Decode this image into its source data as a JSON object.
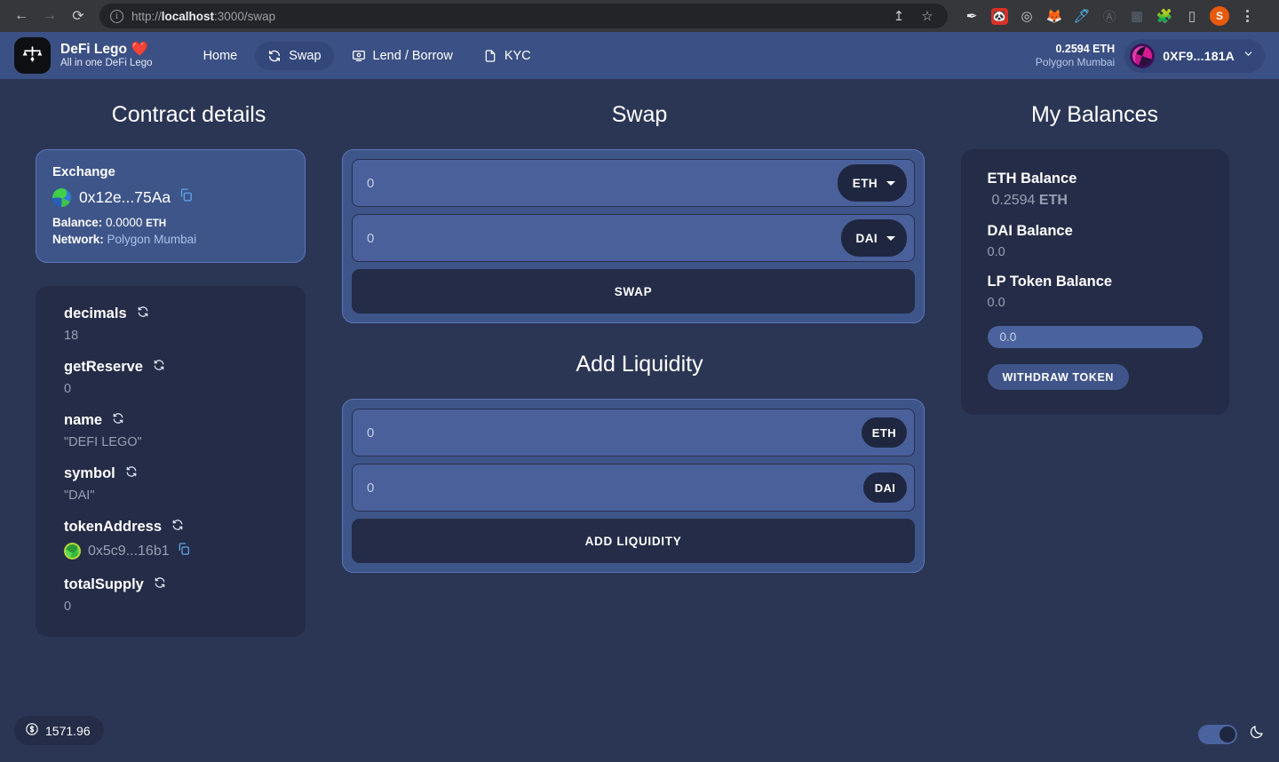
{
  "browser": {
    "back_label": "←",
    "forward_label": "→",
    "reload_label": "⟳",
    "url_prefix": "http://",
    "url_host": "localhost",
    "url_rest": ":3000/swap",
    "share_label": "↥",
    "bookmark_label": "☆",
    "extensions": [
      {
        "name": "pen-extension-icon",
        "glyph": "✒",
        "bg": "transparent",
        "color": "#e8eaed"
      },
      {
        "name": "red-panda-extension-icon",
        "glyph": "🐼",
        "bg": "#d93025",
        "color": "#ffffff"
      },
      {
        "name": "target-extension-icon",
        "glyph": "◎",
        "bg": "transparent",
        "color": "#e8eaed"
      },
      {
        "name": "metamask-extension-icon",
        "glyph": "🦊",
        "bg": "transparent",
        "color": "#f6851b"
      },
      {
        "name": "highlighter-extension-icon",
        "glyph": "🖊",
        "bg": "transparent",
        "color": "#4fc3f7"
      },
      {
        "name": "circle-a-extension-icon",
        "glyph": "Ⓐ",
        "bg": "transparent",
        "color": "#5b6470"
      },
      {
        "name": "grid-extension-icon",
        "glyph": "▦",
        "bg": "transparent",
        "color": "#5b6470"
      },
      {
        "name": "puzzle-extensions-icon",
        "glyph": "🧩",
        "bg": "transparent",
        "color": "#e8eaed"
      },
      {
        "name": "sidepanel-icon",
        "glyph": "▯",
        "bg": "transparent",
        "color": "#e8eaed"
      }
    ],
    "profile_initial": "S"
  },
  "header": {
    "brand_name": "DeFi Lego",
    "brand_heart": "❤️",
    "brand_tagline": "All in one DeFi Lego",
    "nav": [
      {
        "label": "Home",
        "icon": "none",
        "active": false
      },
      {
        "label": "Swap",
        "icon": "swap-icon",
        "active": true
      },
      {
        "label": "Lend / Borrow",
        "icon": "monitor-icon",
        "active": false
      },
      {
        "label": "KYC",
        "icon": "document-icon",
        "active": false
      }
    ],
    "wallet_balance": "0.2594 ETH",
    "wallet_network": "Polygon Mumbai",
    "wallet_address": "0XF9...181A"
  },
  "contract": {
    "title": "Contract details",
    "exchange": {
      "heading": "Exchange",
      "address": "0x12e...75Aa",
      "balance_label": "Balance:",
      "balance_value": "0.0000",
      "balance_unit": "ETH",
      "network_label": "Network:",
      "network_value": "Polygon Mumbai"
    },
    "functions": [
      {
        "name": "decimals",
        "value": "18",
        "is_address": false
      },
      {
        "name": "getReserve",
        "value": "0",
        "is_address": false
      },
      {
        "name": "name",
        "value": "\"DEFI LEGO\"",
        "is_address": false
      },
      {
        "name": "symbol",
        "value": "\"DAI\"",
        "is_address": false
      },
      {
        "name": "tokenAddress",
        "value": "0x5c9...16b1",
        "is_address": true
      },
      {
        "name": "totalSupply",
        "value": "0",
        "is_address": false
      }
    ]
  },
  "swap": {
    "title": "Swap",
    "input_from_placeholder": "0",
    "input_from_value": "",
    "token_from": "ETH",
    "input_to_placeholder": "0",
    "input_to_value": "",
    "token_to": "DAI",
    "button_label": "SWAP"
  },
  "liquidity": {
    "title": "Add Liquidity",
    "input_eth_placeholder": "0",
    "input_eth_value": "",
    "token_eth": "ETH",
    "input_dai_placeholder": "0",
    "input_dai_value": "",
    "token_dai": "DAI",
    "button_label": "ADD LIQUIDITY"
  },
  "balances": {
    "title": "My Balances",
    "eth_label": "ETH Balance",
    "eth_value": "0.2594",
    "eth_unit": "ETH",
    "dai_label": "DAI Balance",
    "dai_value": "0.0",
    "lp_label": "LP Token Balance",
    "lp_value": "0.0",
    "withdraw_placeholder": "0.0",
    "withdraw_value": "",
    "withdraw_button": "WITHDRAW TOKEN"
  },
  "footer": {
    "price_value": "1571.96",
    "price_icon": "dollar-circle-icon",
    "theme_toggle_state": "on",
    "theme_icon": "moon-icon"
  },
  "colors": {
    "page_bg": "#2b3655",
    "header_bg": "#3b5084",
    "panel_light": "#3e5589",
    "panel_dark": "#242c47",
    "accent_blue": "#49609b",
    "muted_text": "#98a0b3"
  }
}
